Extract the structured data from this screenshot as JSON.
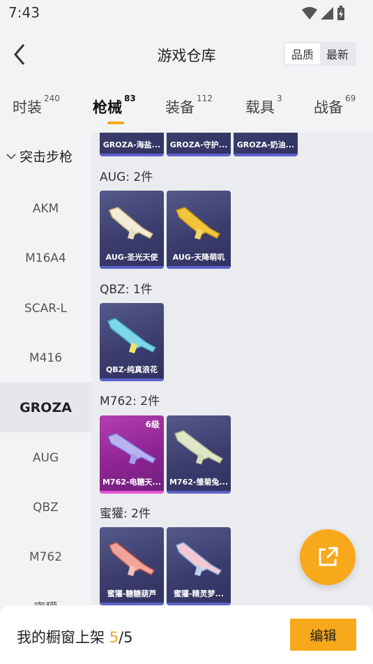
{
  "status": {
    "time": "7:43"
  },
  "header": {
    "title": "游戏仓库",
    "sort_options": [
      "品质",
      "最新"
    ],
    "active_sort": "品质"
  },
  "tabs": [
    {
      "label": "时装",
      "count": "240"
    },
    {
      "label": "枪械",
      "count": "83"
    },
    {
      "label": "装备",
      "count": "112"
    },
    {
      "label": "载具",
      "count": "3"
    },
    {
      "label": "战备",
      "count": "69"
    }
  ],
  "active_tab": "枪械",
  "sidebar": {
    "category": "突击步枪",
    "items": [
      "AKM",
      "M16A4",
      "SCAR-L",
      "M416",
      "GROZA",
      "AUG",
      "QBZ",
      "M762",
      "蜜獾"
    ],
    "active": "GROZA"
  },
  "groups": [
    {
      "title": "",
      "items": [
        {
          "name": "GROZA-海盐...",
          "style": "blue"
        },
        {
          "name": "GROZA-守护...",
          "style": "blue"
        },
        {
          "name": "GROZA-奶油...",
          "style": "blue"
        }
      ]
    },
    {
      "title": "AUG: 2件",
      "items": [
        {
          "name": "AUG-圣光天使",
          "style": "blue"
        },
        {
          "name": "AUG-天降萌叽",
          "style": "blue"
        }
      ]
    },
    {
      "title": "QBZ: 1件",
      "items": [
        {
          "name": "QBZ-纯真浪花",
          "style": "blue"
        }
      ]
    },
    {
      "title": "M762: 2件",
      "items": [
        {
          "name": "M762-电糖天...",
          "style": "pink",
          "level": "6级"
        },
        {
          "name": "M762-雏菊兔...",
          "style": "blue"
        }
      ]
    },
    {
      "title": "蜜獾: 2件",
      "items": [
        {
          "name": "蜜獾-糖糖葫芦",
          "style": "blue"
        },
        {
          "name": "蜜獾-精灵梦...",
          "style": "blue"
        }
      ]
    }
  ],
  "bottom": {
    "label": "我的橱窗上架 ",
    "count": "5",
    "total": "/5",
    "edit_label": "编辑"
  },
  "colors": {
    "accent": "#f8a81b",
    "card_blue": "#3b3d6d",
    "card_pink": "#8e2393"
  }
}
